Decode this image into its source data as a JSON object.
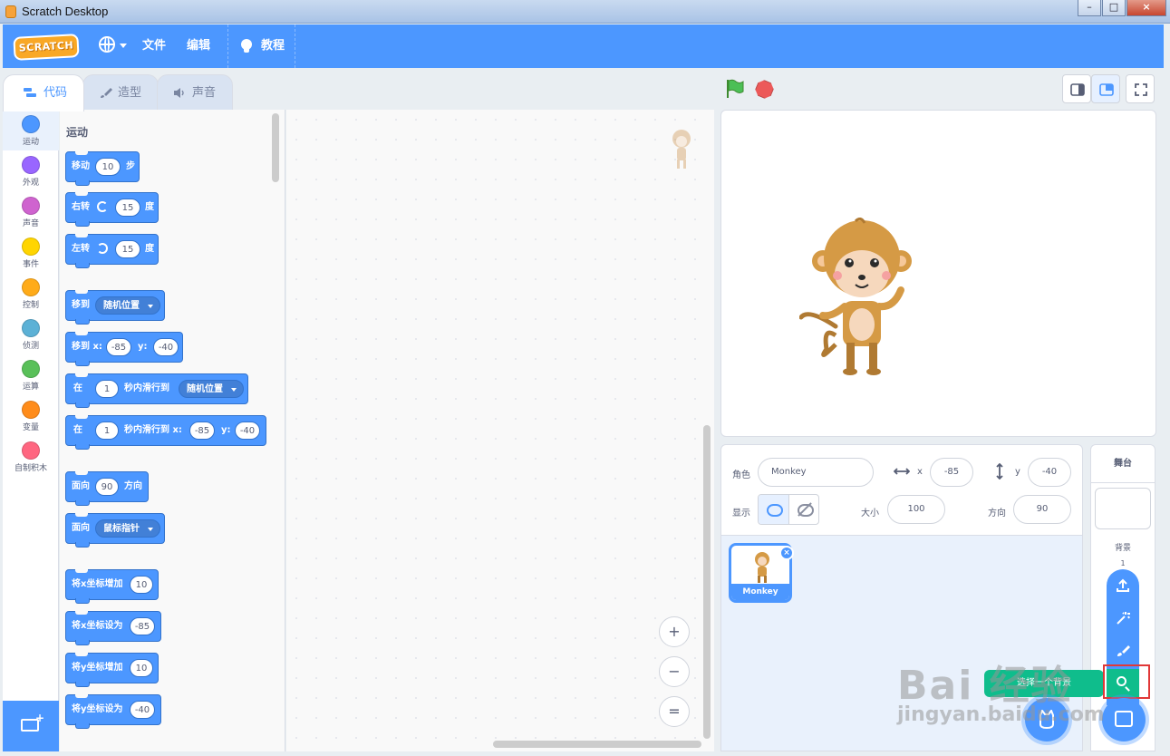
{
  "window": {
    "title": "Scratch Desktop",
    "minimize": "–",
    "maximize": "□",
    "close": "×"
  },
  "menubar": {
    "logo": "SCRATCH",
    "file": "文件",
    "edit": "编辑",
    "tutorials": "教程"
  },
  "tabs": [
    {
      "label": "代码"
    },
    {
      "label": "造型"
    },
    {
      "label": "声音"
    }
  ],
  "categories": [
    {
      "label": "运动",
      "color": "#4c97ff"
    },
    {
      "label": "外观",
      "color": "#9966ff"
    },
    {
      "label": "声音",
      "color": "#cf63cf"
    },
    {
      "label": "事件",
      "color": "#ffd500"
    },
    {
      "label": "控制",
      "color": "#ffab19"
    },
    {
      "label": "侦测",
      "color": "#5cb1d6"
    },
    {
      "label": "运算",
      "color": "#59c059"
    },
    {
      "label": "变量",
      "color": "#ff8c1a"
    },
    {
      "label": "自制积木",
      "color": "#ff6680"
    }
  ],
  "palette": {
    "title": "运动",
    "blocks": {
      "move": {
        "a": "移动",
        "v": "10",
        "b": "步"
      },
      "turn_right": {
        "a": "右转",
        "v": "15",
        "b": "度"
      },
      "turn_left": {
        "a": "左转",
        "v": "15",
        "b": "度"
      },
      "goto": {
        "a": "移到",
        "dd": "随机位置"
      },
      "goto_xy": {
        "a": "移到 x:",
        "x": "-85",
        "yl": "y:",
        "y": "-40"
      },
      "glide": {
        "a": "在",
        "v": "1",
        "b": "秒内滑行到",
        "dd": "随机位置"
      },
      "glide_xy": {
        "a": "在",
        "v": "1",
        "b": "秒内滑行到 x:",
        "x": "-85",
        "yl": "y:",
        "y": "-40"
      },
      "point_dir": {
        "a": "面向",
        "v": "90",
        "b": "方向"
      },
      "point_towards": {
        "a": "面向",
        "dd": "鼠标指针"
      },
      "change_x": {
        "a": "将x坐标增加",
        "v": "10"
      },
      "set_x": {
        "a": "将x坐标设为",
        "v": "-85"
      },
      "change_y": {
        "a": "将y坐标增加",
        "v": "10"
      },
      "set_y": {
        "a": "将y坐标设为",
        "v": "-40"
      }
    }
  },
  "zoom": {
    "in": "+",
    "out": "−",
    "reset": "="
  },
  "sprite_info": {
    "sprite_label": "角色",
    "sprite_name": "Monkey",
    "x_label": "x",
    "x": "-85",
    "y_label": "y",
    "y": "-40",
    "show_label": "显示",
    "size_label": "大小",
    "size": "100",
    "direction_label": "方向",
    "direction": "90"
  },
  "sprites": [
    {
      "name": "Monkey"
    }
  ],
  "stage_panel": {
    "title": "舞台",
    "backdrop_label": "背景",
    "backdrop_count": "1"
  },
  "tooltip": "选择一个背景",
  "watermark": {
    "brand": "Bai 经验",
    "url": "jingyan.baidu.com"
  },
  "colors": {
    "accent": "#4c97ff",
    "motion": "#4c97ff",
    "green": "#0fbd8c",
    "highlight": "#e13838"
  }
}
